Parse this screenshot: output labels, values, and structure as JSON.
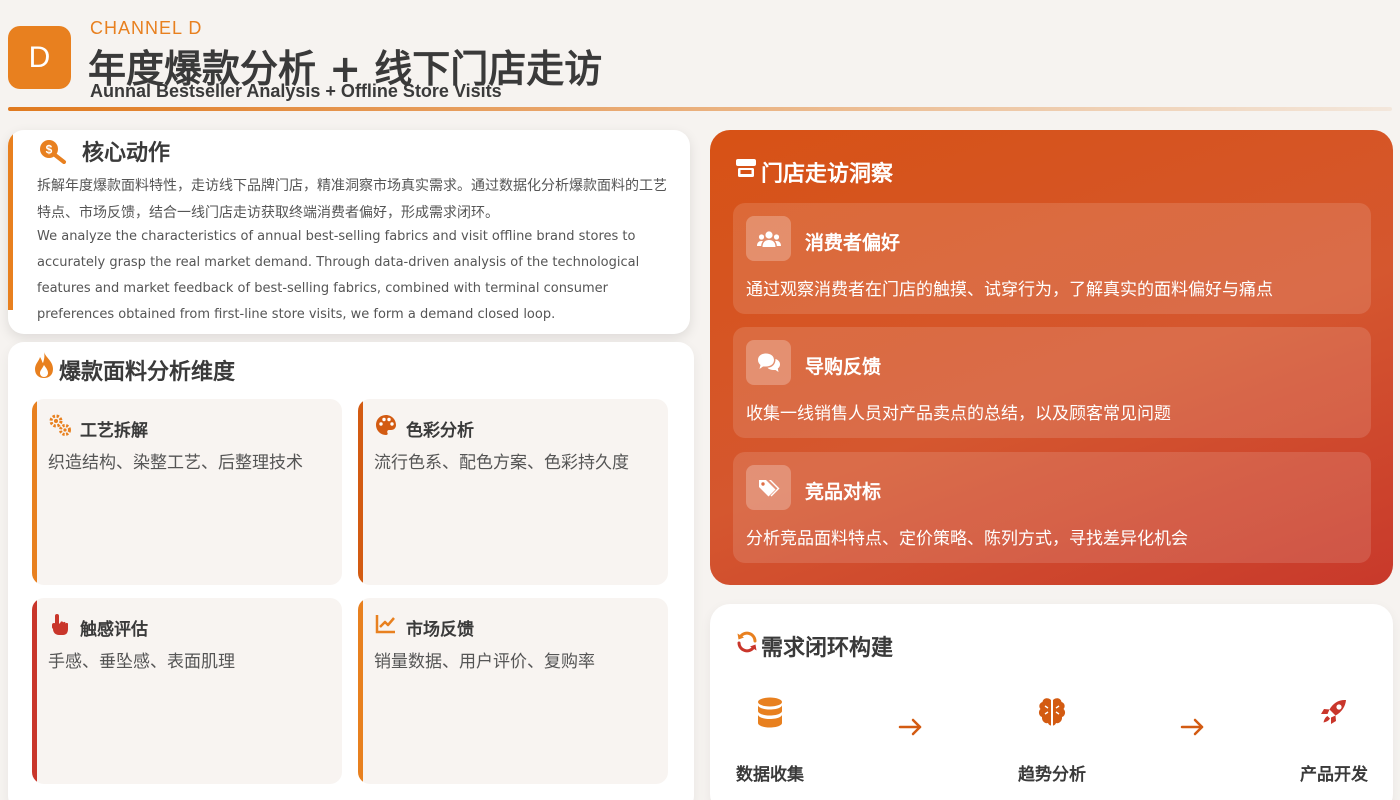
{
  "header": {
    "badge": "D",
    "channel": "CHANNEL D",
    "title": "年度爆款分析 + 线下门店走访",
    "subtitle": "Aunnal Bestseller Analysis + Offline Store Visits"
  },
  "core": {
    "icon": "search-dollar-icon",
    "title": "核心动作",
    "text_zh": "拆解年度爆款面料特性，走访线下品牌门店，精准洞察市场真实需求。通过数据化分析爆款面料的工艺特点、市场反馈，结合一线门店走访获取终端消费者偏好，形成需求闭环。",
    "text_en": "We analyze the characteristics of annual best-selling fabrics and visit offline brand stores to accurately grasp the real market demand. Through data-driven analysis of the technological features and market feedback of best-selling fabrics, combined with terminal consumer preferences obtained from first-line store visits, we form a demand closed loop."
  },
  "analysis": {
    "icon": "fire-icon",
    "title": "爆款面料分析维度",
    "items": [
      {
        "icon": "gears-icon",
        "title": "工艺拆解",
        "desc": "织造结构、染整工艺、后整理技术",
        "color": "#e8801f"
      },
      {
        "icon": "palette-icon",
        "title": "色彩分析",
        "desc": "流行色系、配色方案、色彩持久度",
        "color": "#d35b12"
      },
      {
        "icon": "hand-pointer-icon",
        "title": "触感评估",
        "desc": "手感、垂坠感、表面肌理",
        "color": "#c9362b"
      },
      {
        "icon": "chart-line-icon",
        "title": "市场反馈",
        "desc": "销量数据、用户评价、复购率",
        "color": "#e8801f"
      }
    ]
  },
  "store": {
    "icon": "store-icon",
    "title": "门店走访洞察",
    "items": [
      {
        "icon": "users-icon",
        "title": "消费者偏好",
        "desc": "通过观察消费者在门店的触摸、试穿行为，了解真实的面料偏好与痛点"
      },
      {
        "icon": "comments-icon",
        "title": "导购反馈",
        "desc": "收集一线销售人员对产品卖点的总结，以及顾客常见问题"
      },
      {
        "icon": "tags-icon",
        "title": "竞品对标",
        "desc": "分析竞品面料特点、定价策略、陈列方式，寻找差异化机会"
      }
    ]
  },
  "loop": {
    "icon": "sync-icon",
    "title": "需求闭环构建",
    "steps": [
      {
        "icon": "database-icon",
        "label": "数据收集",
        "color": "#e8801f"
      },
      {
        "icon": "brain-icon",
        "label": "趋势分析",
        "color": "#d35b12"
      },
      {
        "icon": "rocket-icon",
        "label": "产品开发",
        "color": "#c9362b"
      }
    ],
    "arrow_color": "#d35b12"
  }
}
